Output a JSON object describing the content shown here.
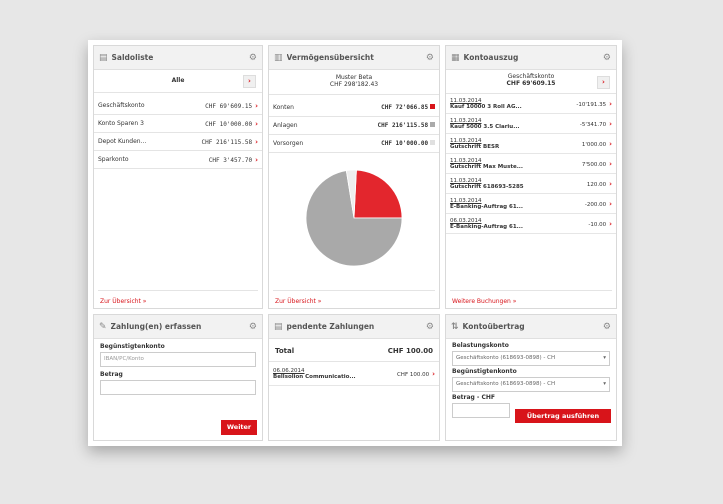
{
  "saldoliste": {
    "title": "Saldoliste",
    "filter": "Alle",
    "rows": [
      {
        "name": "Geschäftskonto",
        "value": "CHF 69'609.15"
      },
      {
        "name": "Konto Sparen 3",
        "value": "CHF 10'000.00"
      },
      {
        "name": "Depot Kunden...",
        "value": "CHF 216'115.58"
      },
      {
        "name": "Sparkonto",
        "value": "CHF 3'457.70"
      }
    ],
    "link": "Zur Übersicht »"
  },
  "vermoegen": {
    "title": "Vermögensübersicht",
    "name": "Muster Beta",
    "total": "CHF 298'182.43",
    "rows": [
      {
        "name": "Konten",
        "value": "CHF 72'066.85",
        "color": "#d8141a"
      },
      {
        "name": "Anlagen",
        "value": "CHF 216'115.58",
        "color": "#aaaaaa"
      },
      {
        "name": "Vorsorgen",
        "value": "CHF 10'000.00",
        "color": "#e0e0e0"
      }
    ],
    "link": "Zur Übersicht »"
  },
  "kontoauszug": {
    "title": "Kontoauszug",
    "account": "Geschäftskonto",
    "balance": "CHF 69'609.15",
    "transactions": [
      {
        "date": "11.03.2014",
        "desc": "Kauf 10000 3 Roll AG...",
        "amount": "-10'191.35"
      },
      {
        "date": "11.03.2014",
        "desc": "Kauf 5000 3.5 Clariu...",
        "amount": "-5'341.70"
      },
      {
        "date": "11.03.2014",
        "desc": "Gutschrift BESR",
        "amount": "1'000.00"
      },
      {
        "date": "11.03.2014",
        "desc": "Gutschrift Max Muste...",
        "amount": "7'500.00"
      },
      {
        "date": "11.03.2014",
        "desc": "Gutschrift 618693-5285",
        "amount": "120.00"
      },
      {
        "date": "11.03.2014",
        "desc": "E-Banking-Auftrag 61...",
        "amount": "-200.00"
      },
      {
        "date": "06.03.2014",
        "desc": "E-Banking-Auftrag 61...",
        "amount": "-10.00"
      }
    ],
    "link": "Weitere Buchungen »"
  },
  "zahlung": {
    "title": "Zahlung(en) erfassen",
    "label_account": "Begünstigtenkonto",
    "account_placeholder": "IBAN/PC/Konto",
    "label_amount": "Betrag",
    "button": "Weiter"
  },
  "pendente": {
    "title": "pendente Zahlungen",
    "total_label": "Total",
    "total_value": "CHF 100.00",
    "item_date": "06.06.2014",
    "item_amount": "CHF 100.00",
    "item_desc": "Bellsolion Communicatio..."
  },
  "kontouebertrag": {
    "title": "Kontoübertrag",
    "label_from": "Belastungskonto",
    "from_value": "Geschäftskonto (618693-0898) - CH",
    "label_to": "Begünstigtenkonto",
    "to_value": "Geschäftskonto (618693-0898) - CH",
    "label_amount": "Betrag - CHF",
    "button": "Übertrag ausführen"
  },
  "pie": {
    "values": [
      72066.85,
      216115.58,
      10000.0
    ],
    "colors": [
      "#e3262d",
      "#a9a9a9",
      "#eeeeee"
    ]
  }
}
